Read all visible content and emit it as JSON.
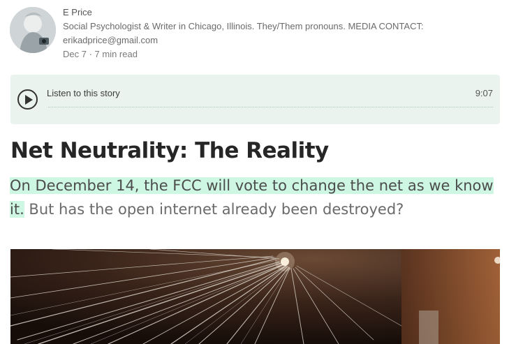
{
  "author": {
    "name": "E Price",
    "bio_line1": "Social Psychologist & Writer in Chicago, Illinois. They/Them pronouns. MEDIA CONTACT:",
    "bio_line2": "erikadprice@gmail.com",
    "date": "Dec 7",
    "separator": " · ",
    "read_time": "7 min read",
    "avatar_icon": "author-avatar"
  },
  "audio": {
    "label": "Listen to this story",
    "duration": "9:07",
    "play_icon": "play-icon",
    "background": "#eaf3ee"
  },
  "article": {
    "title": "Net Neutrality: The Reality",
    "subtitle_highlighted": "On December 14, the FCC will vote to change the net as we know it.",
    "subtitle_rest": " But has the open internet already been destroyed?",
    "highlight_color": "#cdf6e3"
  },
  "hero_image": {
    "description_icon": "fiber-optic-image"
  }
}
